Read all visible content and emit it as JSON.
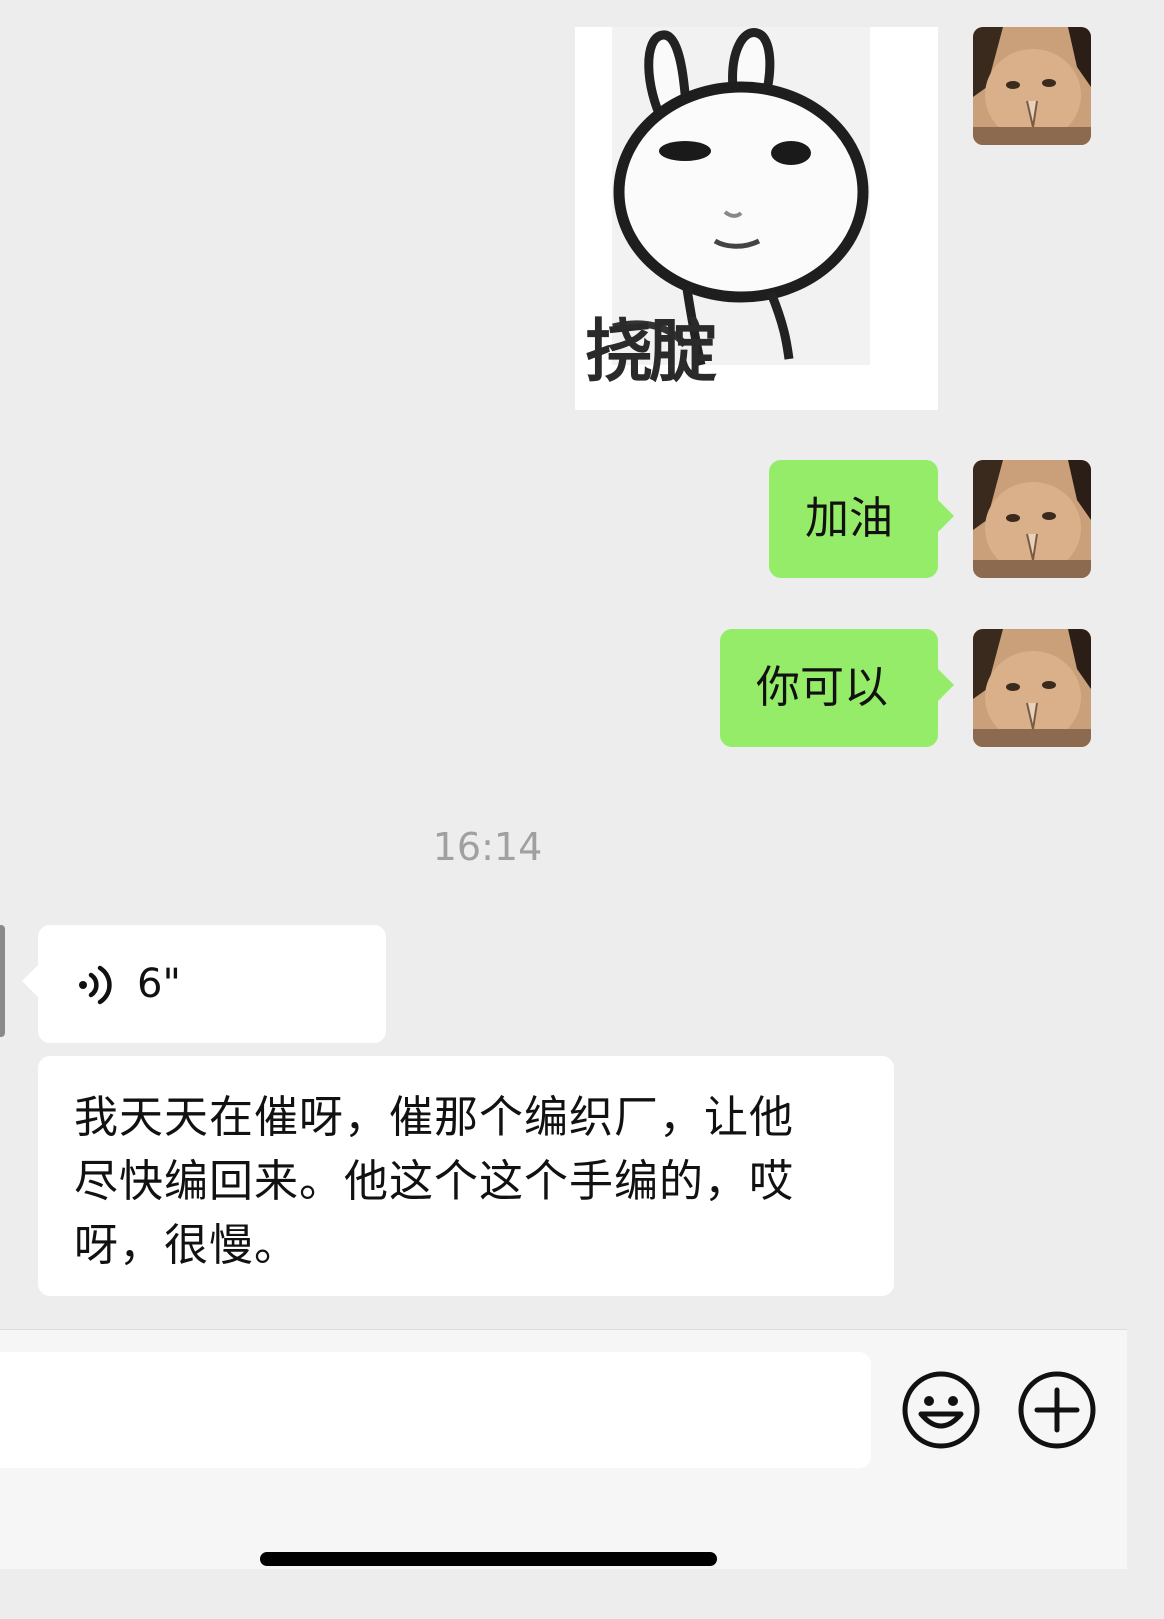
{
  "messages": {
    "sticker": {
      "caption": "挠腚"
    },
    "sent_1": {
      "text": "加油"
    },
    "sent_2": {
      "text": "你可以"
    },
    "timestamp": "16:14",
    "voice": {
      "duration": "6\"",
      "icon": "voice-wave-icon"
    },
    "transcript": {
      "lines": [
        "我天天在催呀，催那个编织厂，让他",
        "尽快编回来。他这个这个手编的，哎",
        "呀，很慢。"
      ]
    }
  },
  "input_bar": {
    "value": "",
    "emoji_icon": "emoji-smile-icon",
    "more_icon": "plus-circle-icon"
  },
  "colors": {
    "background": "#ededed",
    "sent_bubble": "#95ec69",
    "received_bubble": "#ffffff",
    "timestamp": "#a0a0a0"
  }
}
